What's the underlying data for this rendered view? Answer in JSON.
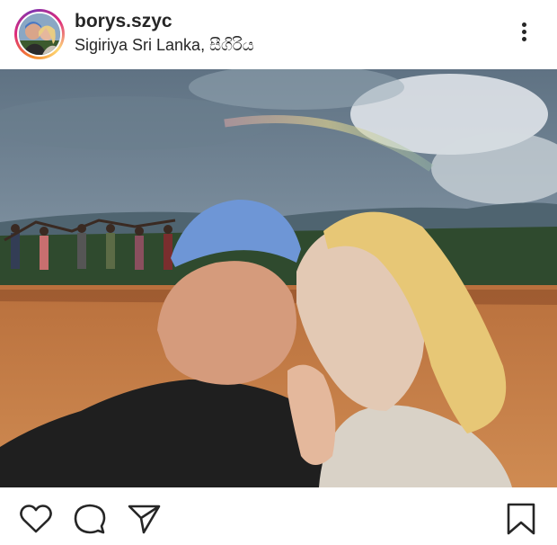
{
  "post": {
    "username": "borys.szyc",
    "location": "Sigiriya Sri Lanka, සීගිරිය"
  },
  "icons": {
    "more": "more-options-icon",
    "like": "heart-icon",
    "comment": "comment-icon",
    "share": "paper-plane-icon",
    "save": "bookmark-icon"
  },
  "colors": {
    "text": "#262626",
    "ring_start": "#f58529",
    "ring_mid": "#dd2a7b",
    "ring_end": "#8134af"
  }
}
